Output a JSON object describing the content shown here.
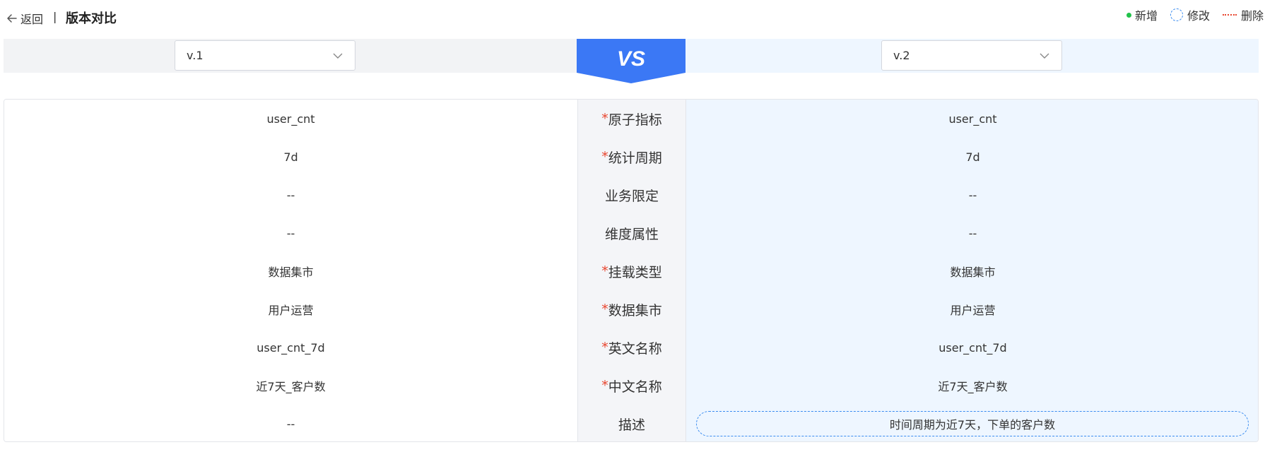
{
  "header": {
    "back_label": "返回",
    "divider": "|",
    "title": "版本对比"
  },
  "legend": {
    "added": "新增",
    "modified": "修改",
    "deleted": "删除",
    "added_color": "#21c24a",
    "modified_color": "#3a8cf0",
    "deleted_color": "#e8452e"
  },
  "versions": {
    "left_selected": "v.1",
    "right_selected": "v.2",
    "vs_label": "VS",
    "vs_color": "#3b78f5"
  },
  "rows": [
    {
      "field": "原子指标",
      "required": true,
      "left": "user_cnt",
      "right": "user_cnt",
      "status": "same"
    },
    {
      "field": "统计周期",
      "required": true,
      "left": "7d",
      "right": "7d",
      "status": "same"
    },
    {
      "field": "业务限定",
      "required": false,
      "left": "--",
      "right": "--",
      "status": "same"
    },
    {
      "field": "维度属性",
      "required": false,
      "left": "--",
      "right": "--",
      "status": "same"
    },
    {
      "field": "挂载类型",
      "required": true,
      "left": "数据集市",
      "right": "数据集市",
      "status": "same"
    },
    {
      "field": "数据集市",
      "required": true,
      "left": "用户运营",
      "right": "用户运营",
      "status": "same"
    },
    {
      "field": "英文名称",
      "required": true,
      "left": "user_cnt_7d",
      "right": "user_cnt_7d",
      "status": "same"
    },
    {
      "field": "中文名称",
      "required": true,
      "left": "近7天_客户数",
      "right": "近7天_客户数",
      "status": "same"
    },
    {
      "field": "描述",
      "required": false,
      "left": "--",
      "right": "时间周期为近7天，下单的客户数",
      "status": "modified"
    }
  ],
  "required_mark": "*"
}
